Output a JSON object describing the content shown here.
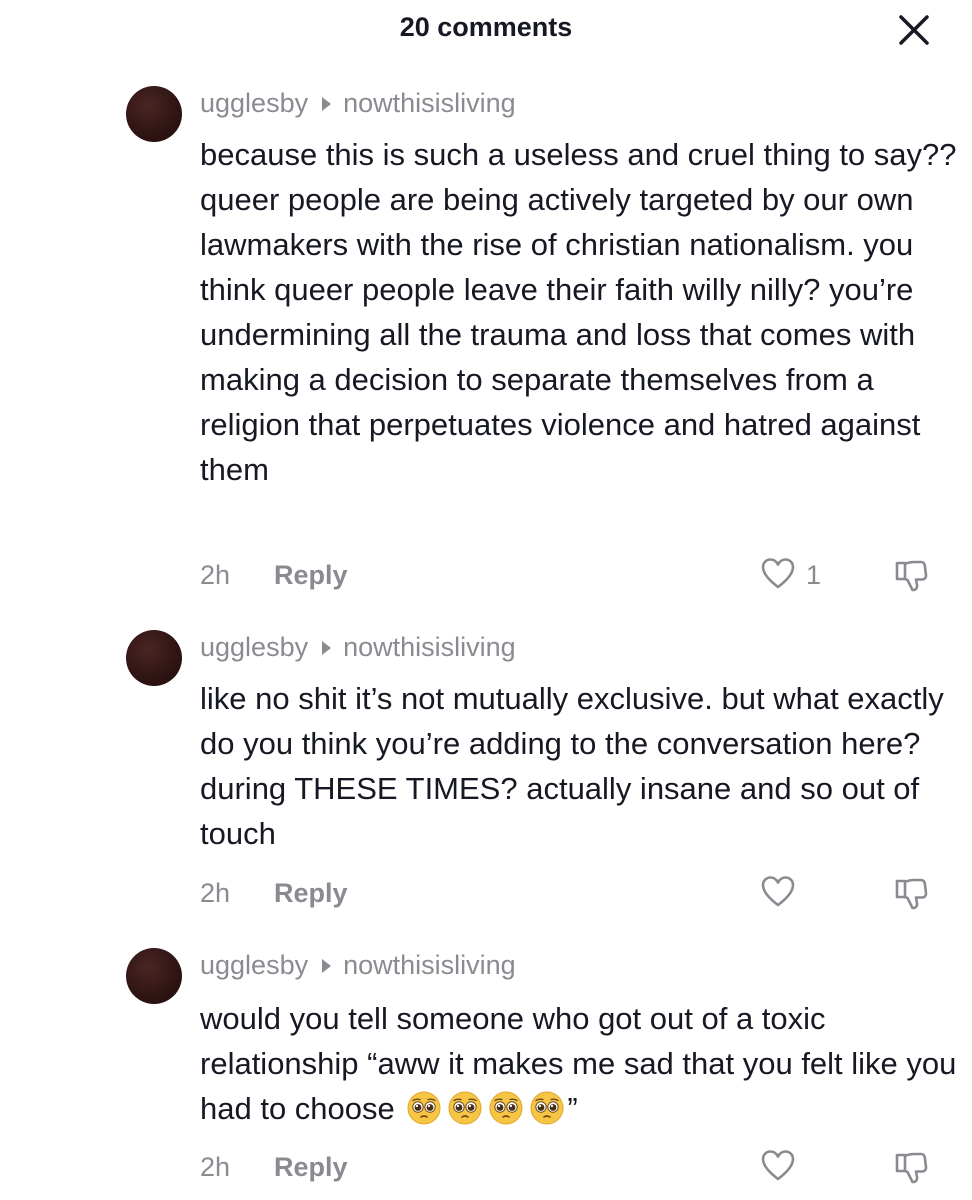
{
  "header": {
    "title": "20 comments",
    "close_icon": "close-icon"
  },
  "comments": [
    {
      "username": "ugglesby",
      "reply_to": "nowthisisliving",
      "text": "because this is such a useless and cruel thing to say?? queer people are being actively targeted by our own lawmakers with the rise of christian nationalism. you think queer people leave their faith willy nilly? you’re undermining all the trauma and loss that comes with making a decision to separate themselves from a religion that perpetuates violence and hatred against them",
      "time": "2h",
      "reply_label": "Reply",
      "likes": "1"
    },
    {
      "username": "ugglesby",
      "reply_to": "nowthisisliving",
      "text": "like no shit it’s not mutually exclusive. but what exactly do you think you’re adding to the conversation here? during THESE TIMES? actually insane and so out of touch",
      "time": "2h",
      "reply_label": "Reply",
      "likes": ""
    },
    {
      "username": "ugglesby",
      "reply_to": "nowthisisliving",
      "text": "would you tell someone who got out of a toxic relationship “aww it makes me sad that you felt like you had to choose",
      "text_end": "”",
      "emoji": [
        "pleading-face",
        "pleading-face",
        "pleading-face",
        "pleading-face"
      ],
      "time": "2h",
      "reply_label": "Reply",
      "likes": ""
    }
  ],
  "colors": {
    "text": "#161823",
    "muted": "#8a8b91",
    "avatar": "#2e1413",
    "emoji": "#f7c544"
  }
}
